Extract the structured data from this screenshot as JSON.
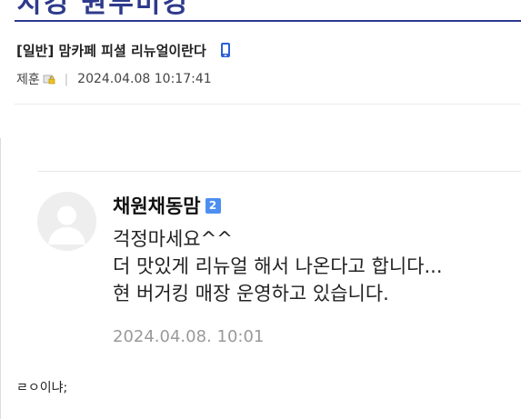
{
  "top_fragment": "치킹 원투미킹",
  "post": {
    "title": "[일반] 맘카페 피셜 리뉴얼이란다",
    "author": "제훈",
    "datetime": "2024.04.08 10:17:41"
  },
  "comment": {
    "author": "채원채동맘",
    "level": "2",
    "lines": [
      "걱정마세요^^",
      "더 맛있게 리뉴얼 해서 나온다고 합니다...",
      "현 버거킹 매장 운영하고 있습니다."
    ],
    "date": "2024.04.08. 10:01"
  },
  "footer_text": "ㄹㅇ이냐;",
  "colors": {
    "accent": "#2d3a8c",
    "badge": "#4d8ff0",
    "date_gray": "#9a9a9a"
  },
  "icons": [
    "mobile-phone-icon",
    "lock-icon",
    "default-avatar-icon"
  ]
}
